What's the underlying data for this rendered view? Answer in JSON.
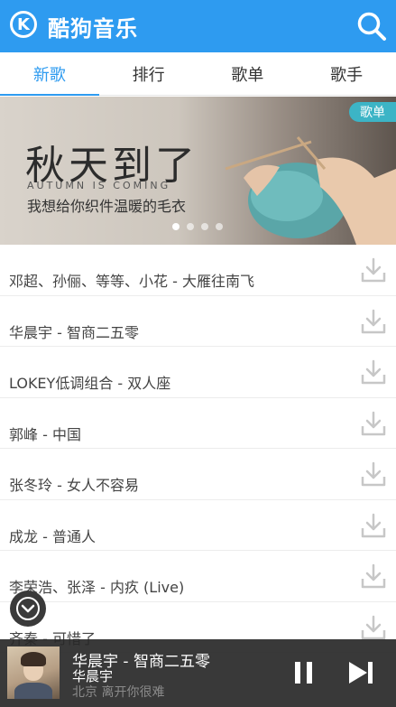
{
  "header": {
    "logo_letter": "K",
    "title": "酷狗音乐"
  },
  "tabs": [
    {
      "label": "新歌"
    },
    {
      "label": "排行"
    },
    {
      "label": "歌单"
    },
    {
      "label": "歌手"
    }
  ],
  "banner": {
    "tag": "歌单",
    "title": "秋天到了",
    "subtitle_en": "AUTUMN IS COMING",
    "subtitle": "我想给你织件温暖的毛衣",
    "slides": 4,
    "active_slide": 1
  },
  "songs": [
    "邓超、孙俪、等等、小花 - 大雁往南飞",
    "华晨宇 - 智商二五零",
    "LOKEY低调组合 - 双人座",
    "郭峰 - 中国",
    "张冬玲 - 女人不容易",
    "成龙 - 普通人",
    "李荣浩、张泽 - 内疚 (Live)",
    "齐秦 - 可惜了"
  ],
  "player": {
    "title": "华晨宇 - 智商二五零",
    "artist": "华晨宇",
    "lyric": "北京 离开你很难"
  },
  "colors": {
    "brand": "#2e9bf0",
    "tag": "#3cb4c6",
    "player_bg": "#282828"
  }
}
